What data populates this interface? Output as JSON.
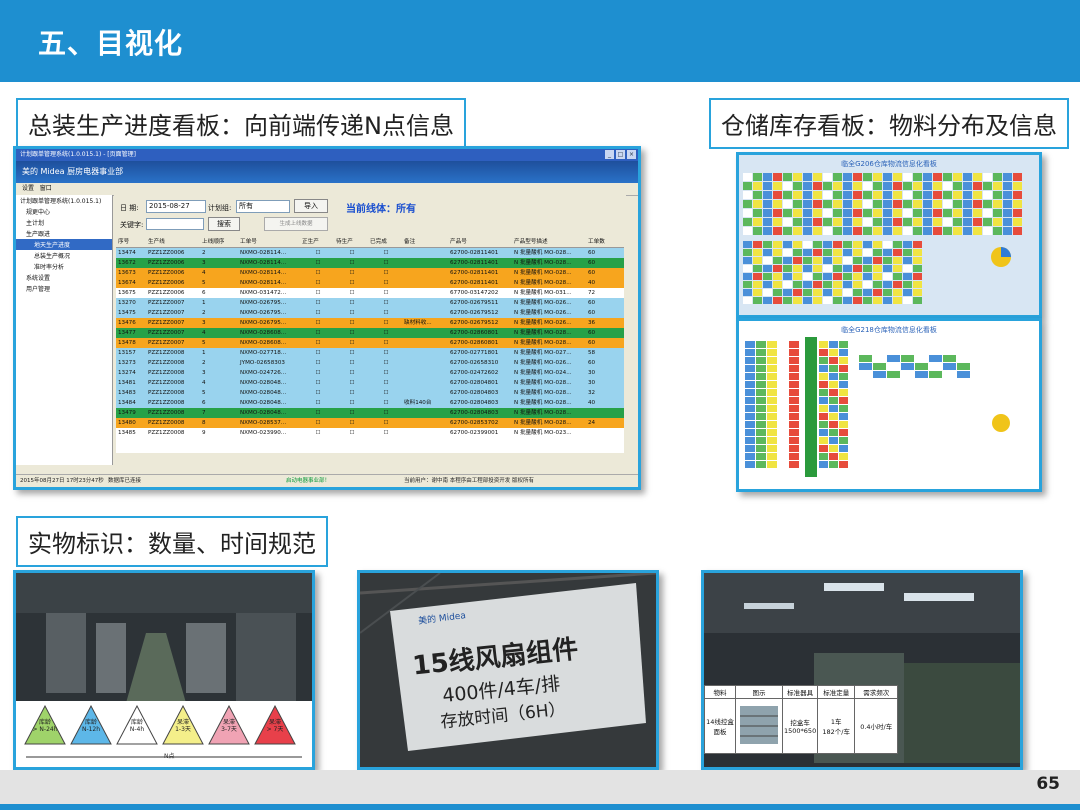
{
  "slide": {
    "title": "五、目视化",
    "page_number": "65"
  },
  "sections": {
    "assembly_label": "总装生产进度看板：向前端传递N点信息",
    "warehouse_label": "仓储库存看板：物料分布及信息",
    "physical_label": "实物标识：数量、时间规范"
  },
  "app": {
    "window_title": "计划跟单管理系统(1.0.015.1) - [页面管理]",
    "brand": "美的 Midea   厨房电器事业部",
    "menu": [
      "设置",
      "窗口"
    ],
    "tree": [
      "计划跟单管理系统(1.0.015.1)",
      "规更中心",
      "主计划",
      "生产跟进",
      "地天生产进度",
      "总装生产概况",
      "准时率分析",
      "系统设置",
      "用户管理"
    ],
    "date_label": "日  期:",
    "date_value": "2015-08-27",
    "plan_group_label": "计划组:",
    "plan_group_value": "所有",
    "import_button": "导入",
    "current_line": "当前线体：所有",
    "keyword_label": "关键字:",
    "search_button": "搜索",
    "generate_button": "生成上线数据",
    "columns": [
      "序号",
      "生产线",
      "上线顺序",
      "工单号",
      "正生产",
      "待生产",
      "已完成",
      "备注",
      "产品号",
      "产品型号描述",
      "工单数"
    ],
    "rows": [
      {
        "id": "13474",
        "line": "PZZ1ZZ0006",
        "seq": "2",
        "order": "NXMO-028114...",
        "note": "",
        "product": "62700-02811401",
        "desc": "N 批量酸机 MO-028...",
        "qty": "60",
        "color": "#99d3ee"
      },
      {
        "id": "13672",
        "line": "PZZ1ZZ0006",
        "seq": "3",
        "order": "NXMO-028114...",
        "note": "",
        "product": "62700-02811401",
        "desc": "N 批量酸机 MO-028...",
        "qty": "60",
        "color": "#27a148"
      },
      {
        "id": "13673",
        "line": "PZZ1ZZ0006",
        "seq": "4",
        "order": "NXMO-028114...",
        "note": "",
        "product": "62700-02811401",
        "desc": "N 批量酸机 MO-028...",
        "qty": "60",
        "color": "#f7a51e"
      },
      {
        "id": "13674",
        "line": "PZZ1ZZ0006",
        "seq": "5",
        "order": "NXMO-028114...",
        "note": "",
        "product": "62700-02811401",
        "desc": "N 批量酸机 MO-028...",
        "qty": "40",
        "color": "#f7a51e"
      },
      {
        "id": "13675",
        "line": "PZZ1ZZ0006",
        "seq": "6",
        "order": "NXMO-031472...",
        "note": "",
        "product": "67700-03147202",
        "desc": "N 批量酸机 MO-031...",
        "qty": "72",
        "color": "#ffffff"
      },
      {
        "id": "13270",
        "line": "PZZ1ZZ0007",
        "seq": "1",
        "order": "NXMO-026795...",
        "note": "",
        "product": "62700-02679511",
        "desc": "N 批量酸机 MO-026...",
        "qty": "60",
        "color": "#99d3ee"
      },
      {
        "id": "13475",
        "line": "PZZ1ZZ0007",
        "seq": "2",
        "order": "NXMO-026795...",
        "note": "",
        "product": "62700-02679512",
        "desc": "N 批量酸机 MO-026...",
        "qty": "60",
        "color": "#99d3ee"
      },
      {
        "id": "13476",
        "line": "PZZ1ZZ0007",
        "seq": "3",
        "order": "NXMO-026795...",
        "note": "缺材料收...",
        "product": "62700-02679512",
        "desc": "N 批量酸机 MO-026...",
        "qty": "36",
        "color": "#f7a51e"
      },
      {
        "id": "13477",
        "line": "PZZ1ZZ0007",
        "seq": "4",
        "order": "NXMO-028608...",
        "note": "",
        "product": "62700-02860801",
        "desc": "N 批量酸机 MO-028...",
        "qty": "60",
        "color": "#27a148"
      },
      {
        "id": "13478",
        "line": "PZZ1ZZ0007",
        "seq": "5",
        "order": "NXMO-028608...",
        "note": "",
        "product": "62700-02860801",
        "desc": "N 批量酸机 MO-028...",
        "qty": "60",
        "color": "#f7a51e"
      },
      {
        "id": "13157",
        "line": "PZZ1ZZ0008",
        "seq": "1",
        "order": "NXMO-027718...",
        "note": "",
        "product": "62700-02771801",
        "desc": "N 批量酸机 MO-027...",
        "qty": "58",
        "color": "#99d3ee"
      },
      {
        "id": "13273",
        "line": "PZZ1ZZ0008",
        "seq": "2",
        "order": "JYMO-02658303",
        "note": "",
        "product": "62700-02658310",
        "desc": "N 批量酸机 MO-026...",
        "qty": "60",
        "color": "#99d3ee"
      },
      {
        "id": "13274",
        "line": "PZZ1ZZ0008",
        "seq": "3",
        "order": "NXMO-024726...",
        "note": "",
        "product": "62700-02472602",
        "desc": "N 批量酸机 MO-024...",
        "qty": "30",
        "color": "#99d3ee"
      },
      {
        "id": "13481",
        "line": "PZZ1ZZ0008",
        "seq": "4",
        "order": "NXMO-028048...",
        "note": "",
        "product": "62700-02804801",
        "desc": "N 批量酸机 MO-028...",
        "qty": "30",
        "color": "#99d3ee"
      },
      {
        "id": "13483",
        "line": "PZZ1ZZ0008",
        "seq": "5",
        "order": "NXMO-028048...",
        "note": "",
        "product": "62700-02804803",
        "desc": "N 批量酸机 MO-028...",
        "qty": "32",
        "color": "#99d3ee"
      },
      {
        "id": "13484",
        "line": "PZZ1ZZ0008",
        "seq": "6",
        "order": "NXMO-028048...",
        "note": "收料140台",
        "product": "62700-02804803",
        "desc": "N 批量酸机 MO-028...",
        "qty": "40",
        "color": "#99d3ee"
      },
      {
        "id": "13479",
        "line": "PZZ1ZZ0008",
        "seq": "7",
        "order": "NXMO-028048...",
        "note": "",
        "product": "62700-02804803",
        "desc": "N 批量酸机 MO-028...",
        "qty": "",
        "color": "#27a148"
      },
      {
        "id": "13480",
        "line": "PZZ1ZZ0008",
        "seq": "8",
        "order": "NXMO-028537...",
        "note": "",
        "product": "62700-02853702",
        "desc": "N 批量酸机 MO-028...",
        "qty": "24",
        "color": "#f7a51e"
      },
      {
        "id": "13485",
        "line": "PZZ1ZZ0008",
        "seq": "9",
        "order": "NXMO-023990...",
        "note": "",
        "product": "62700-02399001",
        "desc": "N 批量酸机 MO-023...",
        "qty": "",
        "color": "#ffffff"
      }
    ],
    "status_left": "2015年08月27日 17时23分47秒",
    "status_mid": "数据库已连接",
    "status_green": "启动电器事业部！",
    "status_right": "当前用户：谢中南   本程序由工程部投资开发 版权所有"
  },
  "warehouse": {
    "board1_title": "临全G206仓库物流信息化看板",
    "board2_title": "临全G218仓库物流信息化看板"
  },
  "photo2": {
    "brand": "美的 Midea",
    "line1": "15线风扇组件",
    "line2": "400件/4车/排",
    "line3": "存放时间（6H）"
  },
  "photo1": {
    "tags": [
      {
        "top": "库",
        "mid": "龄",
        "sub": "> N-24h",
        "color": "#9fd36a"
      },
      {
        "top": "库",
        "mid": "龄",
        "sub": "N-12h",
        "color": "#5db7e8"
      },
      {
        "top": "库",
        "mid": "龄",
        "sub": "N-4h",
        "color": "#ffffff"
      },
      {
        "top": "呆",
        "mid": "滞",
        "sub": "1-3天",
        "color": "#f4ef8a"
      },
      {
        "top": "呆",
        "mid": "滞",
        "sub": "3-7天",
        "color": "#f0a3b4"
      },
      {
        "top": "呆",
        "mid": "滞",
        "sub": "> 7天",
        "color": "#e8404a"
      }
    ],
    "axis_label": "N点"
  },
  "photo3": {
    "headers": [
      "物料",
      "图示",
      "标准器具",
      "标准定量",
      "需求频次"
    ],
    "row": [
      "14线控盒面板",
      "",
      "挖盒车\n1500*650",
      "1车\n182个/车",
      "0.4小时/车"
    ]
  }
}
